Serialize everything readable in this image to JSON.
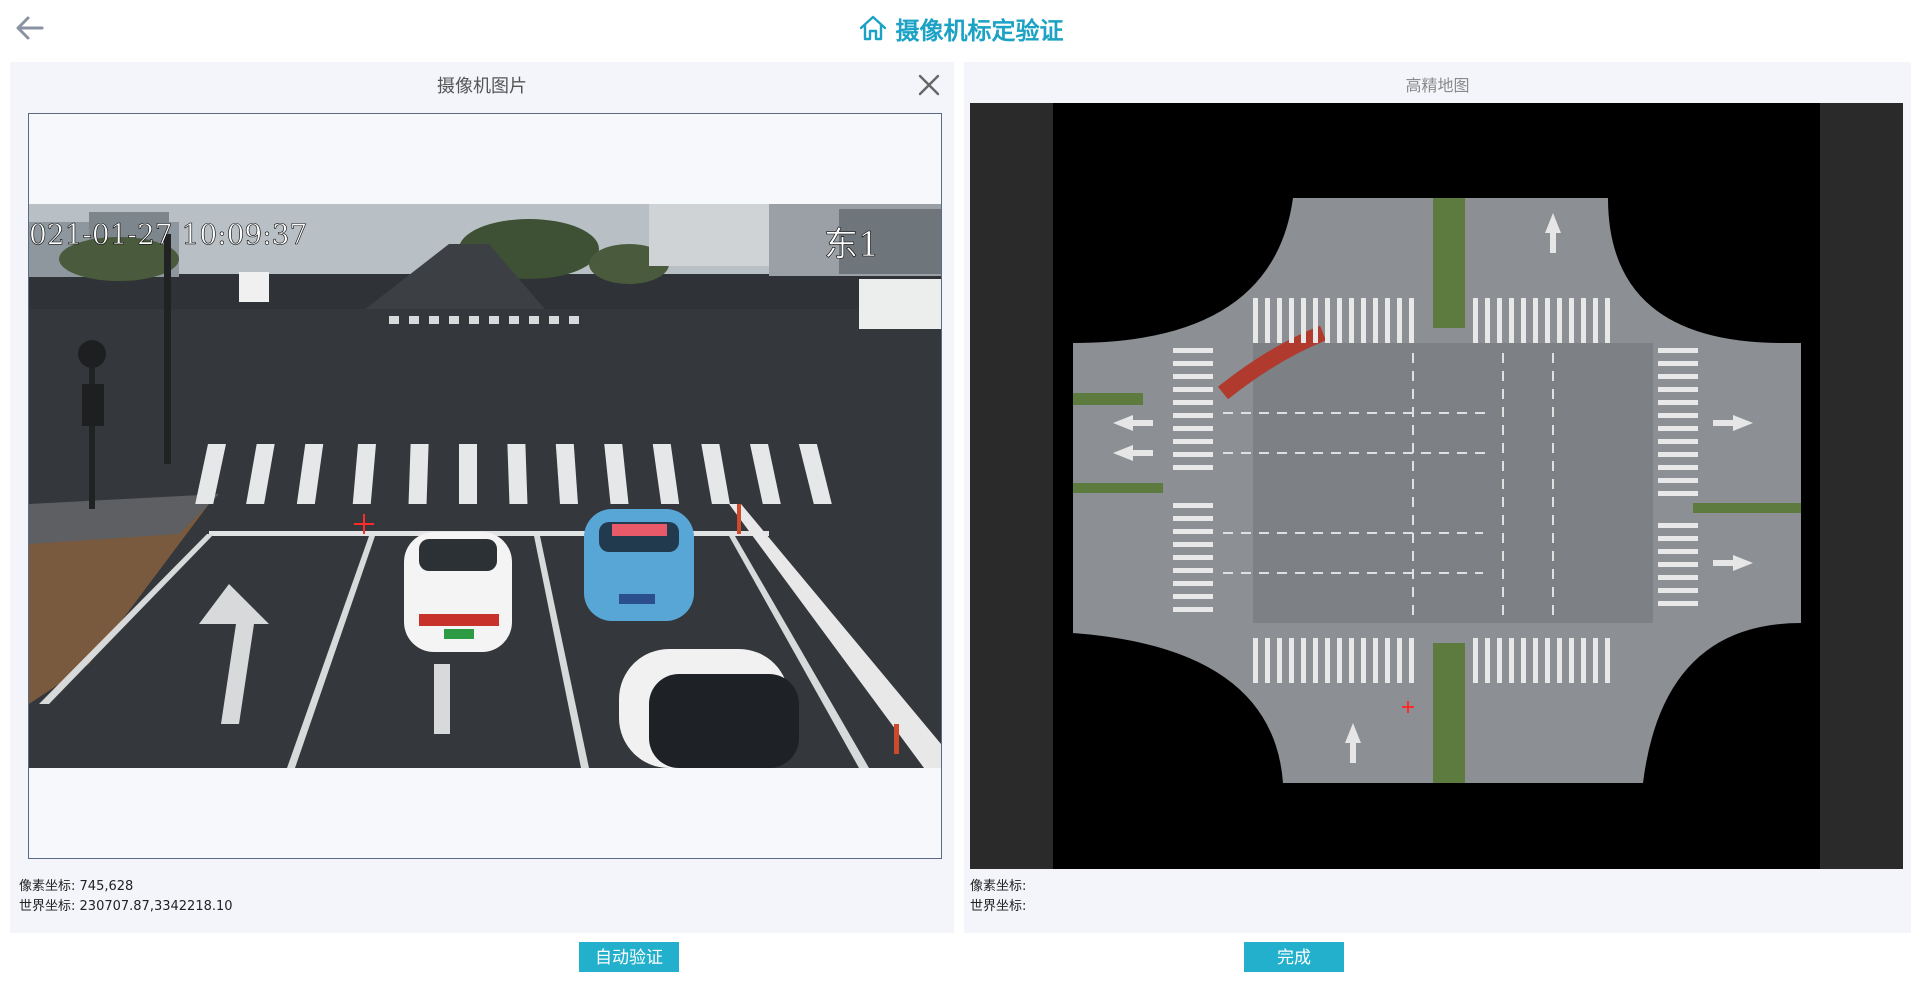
{
  "header": {
    "title": "摄像机标定验证",
    "back_icon": "arrow-left-icon",
    "home_icon": "home-icon",
    "accent_color": "#1ba2c4"
  },
  "left_panel": {
    "title": "摄像机图片",
    "close_icon": "close-icon",
    "image": {
      "timestamp_text": "021-01-27 10:09:37",
      "overlay_label": "东1"
    },
    "pixel_coord_label": "像素坐标:",
    "pixel_coord_value": "745,628",
    "world_coord_label": "世界坐标:",
    "world_coord_value": "230707.87,3342218.10"
  },
  "right_panel": {
    "title": "高精地图",
    "pixel_coord_label": "像素坐标:",
    "pixel_coord_value": "",
    "world_coord_label": "世界坐标:",
    "world_coord_value": ""
  },
  "actions": {
    "auto_verify_label": "自动验证",
    "done_label": "完成",
    "button_color": "#22b0cc"
  }
}
